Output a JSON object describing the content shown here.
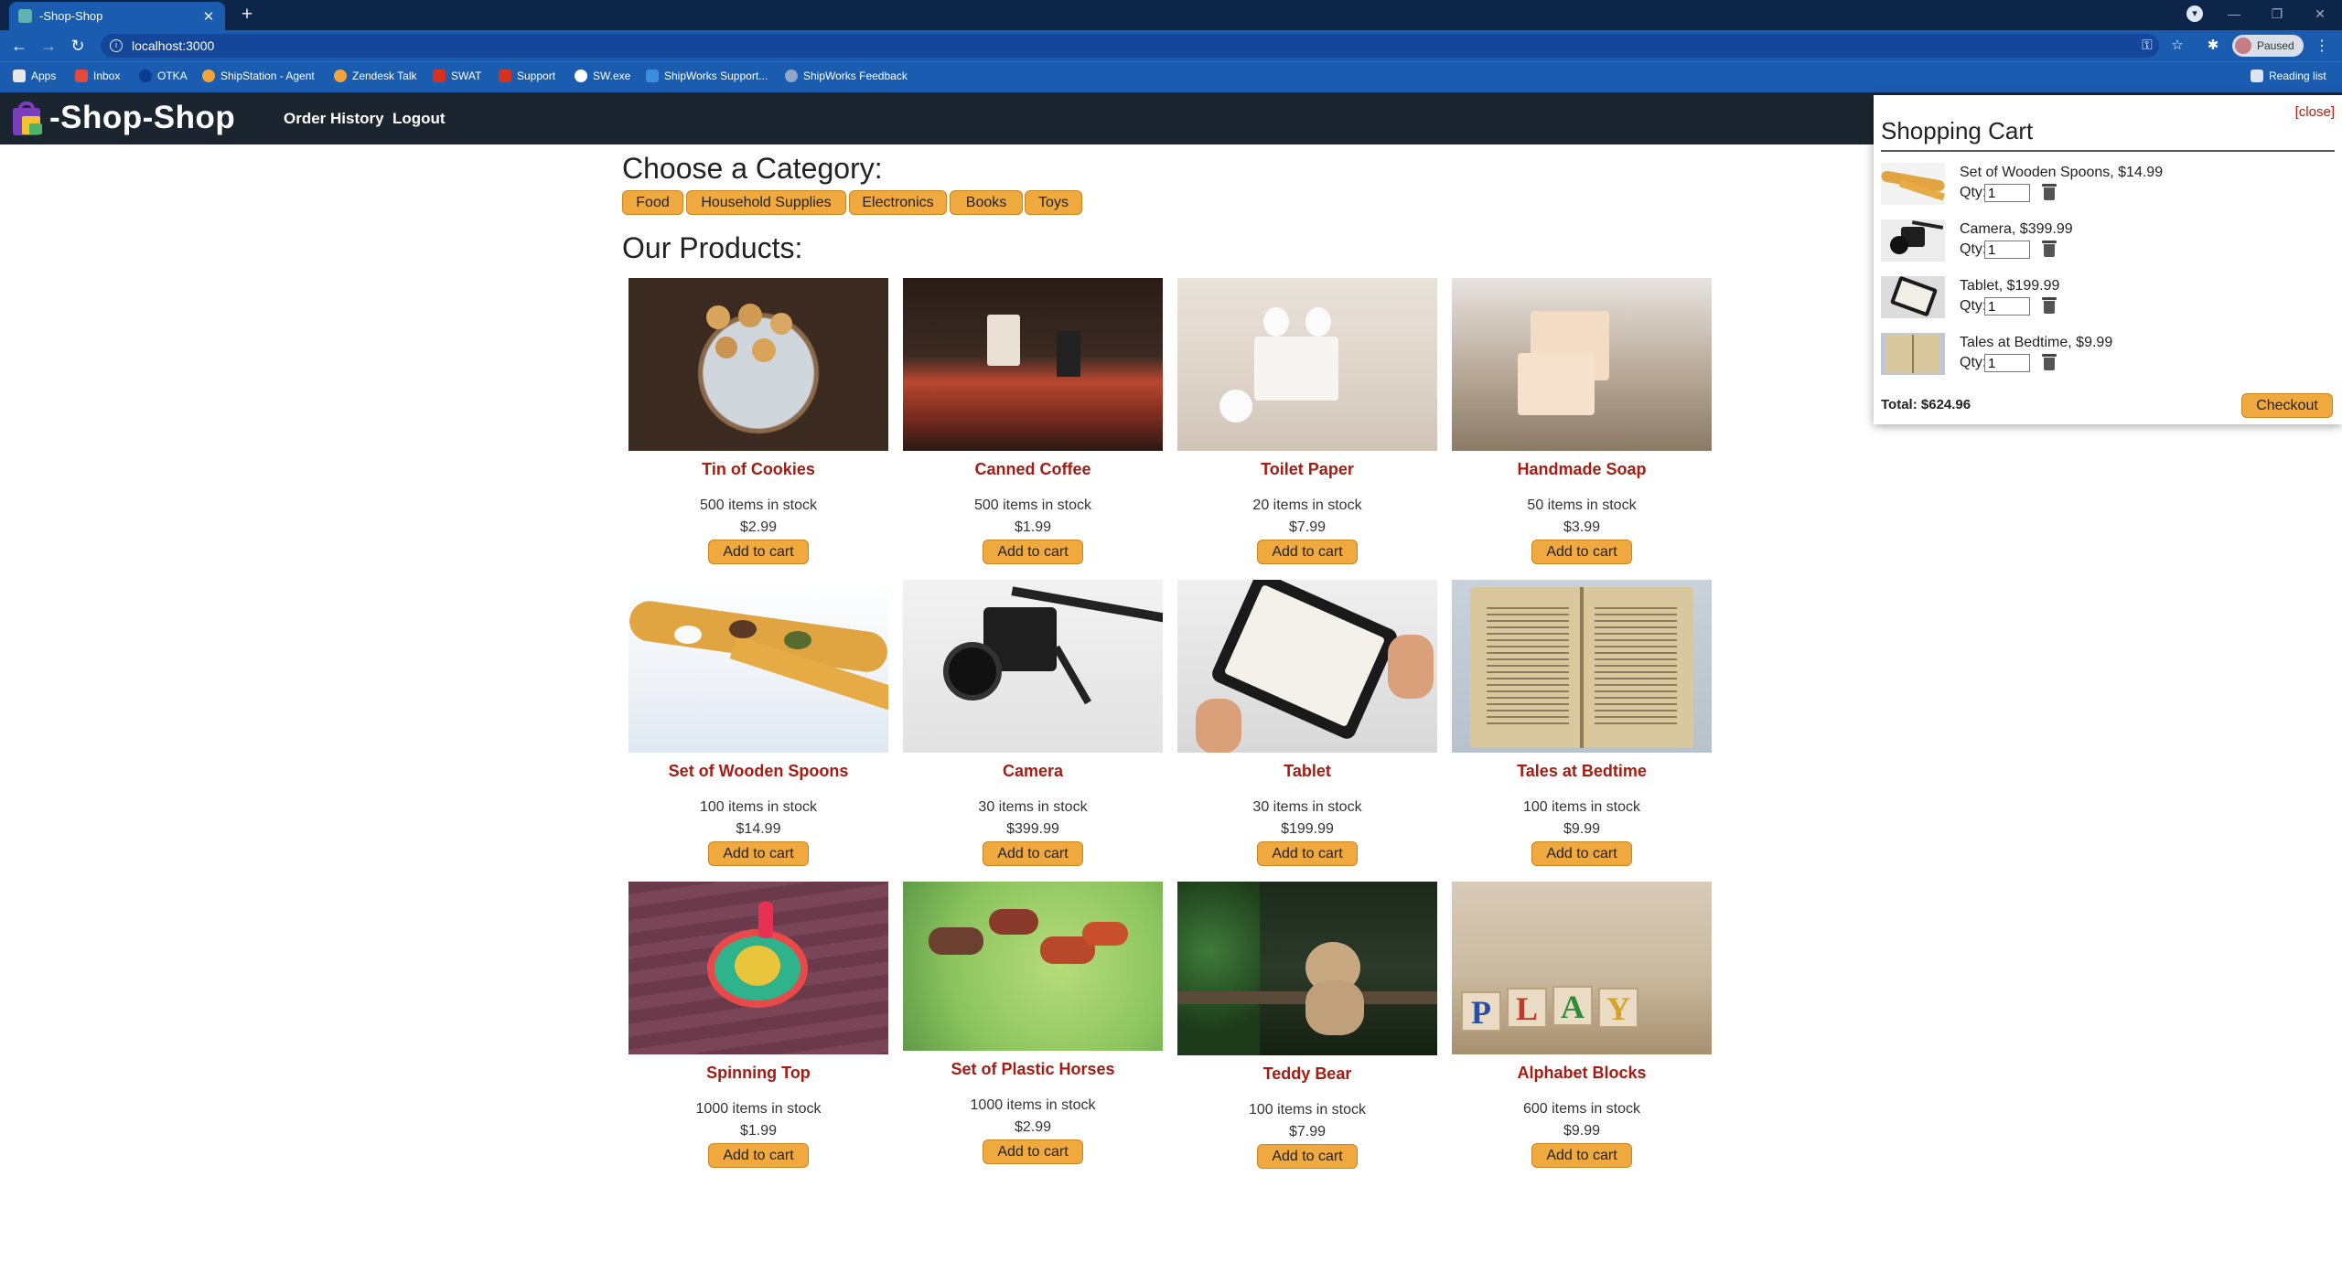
{
  "browser": {
    "tab_title": "-Shop-Shop",
    "url": "localhost:3000",
    "profile_status": "Paused",
    "bookmarks": [
      "Apps",
      "Inbox",
      "OTKA",
      "ShipStation - Agent",
      "Zendesk Talk",
      "SWAT",
      "Support",
      "SW.exe",
      "ShipWorks Support...",
      "ShipWorks Feedback"
    ],
    "reading_list": "Reading list"
  },
  "header": {
    "brand": "-Shop-Shop",
    "nav": [
      "Order History",
      "Logout"
    ]
  },
  "categories": {
    "heading": "Choose a Category:",
    "items": [
      "Food",
      "Household Supplies",
      "Electronics",
      "Books",
      "Toys"
    ]
  },
  "products": {
    "heading": "Our Products:",
    "add_label": "Add to cart",
    "items": [
      {
        "name": "Tin of Cookies",
        "stock": "500 items in stock",
        "price": "$2.99"
      },
      {
        "name": "Canned Coffee",
        "stock": "500 items in stock",
        "price": "$1.99"
      },
      {
        "name": "Toilet Paper",
        "stock": "20 items in stock",
        "price": "$7.99"
      },
      {
        "name": "Handmade Soap",
        "stock": "50 items in stock",
        "price": "$3.99"
      },
      {
        "name": "Set of Wooden Spoons",
        "stock": "100 items in stock",
        "price": "$14.99"
      },
      {
        "name": "Camera",
        "stock": "30 items in stock",
        "price": "$399.99"
      },
      {
        "name": "Tablet",
        "stock": "30 items in stock",
        "price": "$199.99"
      },
      {
        "name": "Tales at Bedtime",
        "stock": "100 items in stock",
        "price": "$9.99"
      },
      {
        "name": "Spinning Top",
        "stock": "1000 items in stock",
        "price": "$1.99"
      },
      {
        "name": "Set of Plastic Horses",
        "stock": "1000 items in stock",
        "price": "$2.99"
      },
      {
        "name": "Teddy Bear",
        "stock": "100 items in stock",
        "price": "$7.99"
      },
      {
        "name": "Alphabet Blocks",
        "stock": "600 items in stock",
        "price": "$9.99"
      }
    ]
  },
  "cart": {
    "close_label": "[close]",
    "title": "Shopping Cart",
    "qty_label": "Qty:",
    "items": [
      {
        "label": "Set of Wooden Spoons, $14.99",
        "qty": "1"
      },
      {
        "label": "Camera, $399.99",
        "qty": "1"
      },
      {
        "label": "Tablet, $199.99",
        "qty": "1"
      },
      {
        "label": "Tales at Bedtime, $9.99",
        "qty": "1"
      }
    ],
    "total": "Total: $624.96",
    "checkout_label": "Checkout"
  }
}
